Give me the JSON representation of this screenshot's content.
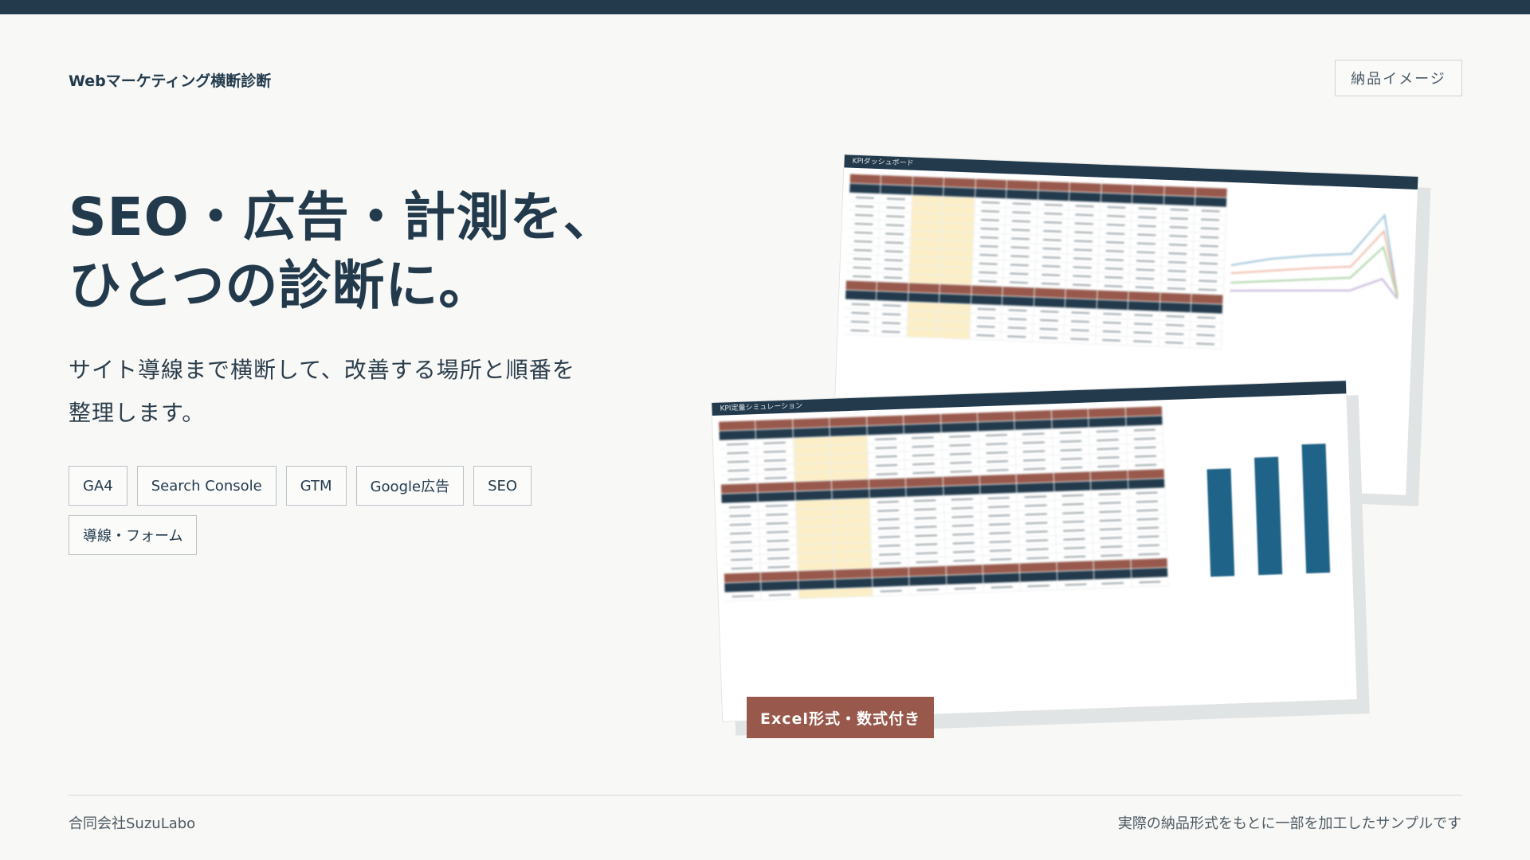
{
  "header": {
    "brand": "Webマーケティング横断診断",
    "badge": "納品イメージ"
  },
  "hero": {
    "headline_line1": "SEO・広告・計測を、",
    "headline_line2": "ひとつの診断に。",
    "lead": "サイト導線まで横断して、改善する場所と順番を整理します。"
  },
  "tags": [
    "GA4",
    "Search Console",
    "GTM",
    "Google広告",
    "SEO",
    "導線・フォーム"
  ],
  "preview": {
    "back_sheet_title": "KPIダッシュボード",
    "front_sheet_title": "KPI定量シミュレーション",
    "excel_badge": "Excel形式・数式付き",
    "bar_values": [
      0.55,
      0.6,
      0.75,
      0.82,
      0.9
    ],
    "colors": {
      "navy": "#223a4c",
      "brick": "#98594c",
      "yellow": "#fcefc7",
      "bar": "#1f6388"
    }
  },
  "footer": {
    "company": "合同会社SuzuLabo",
    "note": "実際の納品形式をもとに一部を加工したサンプルです"
  }
}
